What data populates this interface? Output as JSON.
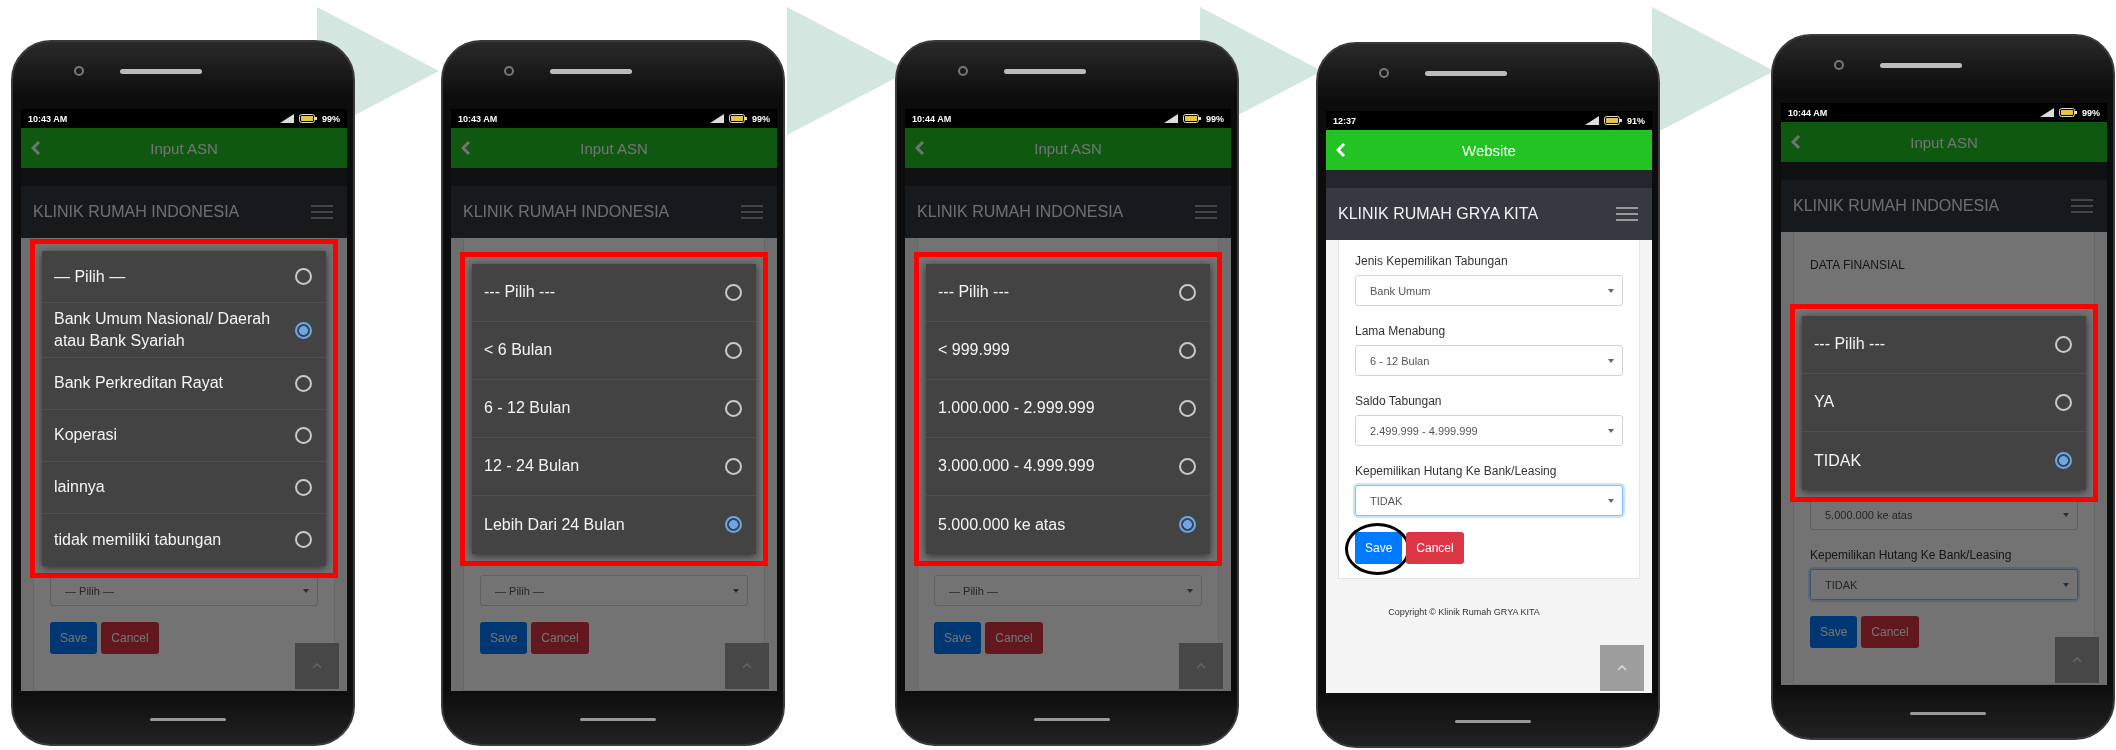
{
  "phones": [
    {
      "status_time": "10:43 AM",
      "battery": "99%",
      "app_title": "Input ASN",
      "site_title": "KLINIK RUMAH INDONESIA",
      "form": {
        "fields": [
          {
            "value": "— Pilih —",
            "focused": false
          }
        ],
        "buttons": [
          {
            "label": "Save",
            "kind": "primary",
            "circled": false
          },
          {
            "label": "Cancel",
            "kind": "danger",
            "circled": false
          }
        ]
      },
      "picker": {
        "highlighted": true,
        "options": [
          {
            "label": "— Pilih —",
            "selected": false
          },
          {
            "label": "Bank Umum Nasional/ Daerah atau Bank Syariah",
            "selected": true
          },
          {
            "label": "Bank Perkreditan Rayat",
            "selected": false
          },
          {
            "label": "Koperasi",
            "selected": false
          },
          {
            "label": "lainnya",
            "selected": false
          },
          {
            "label": "tidak memiliki tabungan",
            "selected": false
          }
        ]
      }
    },
    {
      "status_time": "10:43 AM",
      "battery": "99%",
      "app_title": "Input ASN",
      "site_title": "KLINIK RUMAH INDONESIA",
      "form": {
        "fields": [
          {
            "value": "— Pilih —",
            "focused": false
          }
        ],
        "buttons": [
          {
            "label": "Save",
            "kind": "primary",
            "circled": false
          },
          {
            "label": "Cancel",
            "kind": "danger",
            "circled": false
          }
        ]
      },
      "picker": {
        "highlighted": true,
        "options": [
          {
            "label": "--- Pilih ---",
            "selected": false
          },
          {
            "label": "< 6 Bulan",
            "selected": false
          },
          {
            "label": "6 - 12 Bulan",
            "selected": false
          },
          {
            "label": "12 - 24 Bulan",
            "selected": false
          },
          {
            "label": "Lebih Dari 24 Bulan",
            "selected": true
          }
        ]
      }
    },
    {
      "status_time": "10:44 AM",
      "battery": "99%",
      "app_title": "Input ASN",
      "site_title": "KLINIK RUMAH INDONESIA",
      "form": {
        "fields": [
          {
            "value": "— Pilih —",
            "focused": false
          }
        ],
        "buttons": [
          {
            "label": "Save",
            "kind": "primary",
            "circled": false
          },
          {
            "label": "Cancel",
            "kind": "danger",
            "circled": false
          }
        ]
      },
      "picker": {
        "highlighted": true,
        "options": [
          {
            "label": "--- Pilih ---",
            "selected": false
          },
          {
            "label": "< 999.999",
            "selected": false
          },
          {
            "label": "1.000.000 - 2.999.999",
            "selected": false
          },
          {
            "label": "3.000.000 - 4.999.999",
            "selected": false
          },
          {
            "label": "5.000.000 ke atas",
            "selected": true
          }
        ]
      }
    },
    {
      "status_time": "12:37",
      "battery": "91%",
      "app_title": "Website",
      "site_title": "KLINIK RUMAH GRYA KITA",
      "form": {
        "fields": [
          {
            "label": "Jenis Kepemilikan Tabungan",
            "value": "Bank Umum",
            "focused": false
          },
          {
            "label": "Lama Menabung",
            "value": "6 - 12 Bulan",
            "focused": false
          },
          {
            "label": "Saldo Tabungan",
            "value": "2.499.999 - 4.999.999",
            "focused": false
          },
          {
            "label": "Kepemilikan Hutang Ke Bank/Leasing",
            "value": "TIDAK",
            "focused": true
          }
        ],
        "buttons": [
          {
            "label": "Save",
            "kind": "primary",
            "circled": true
          },
          {
            "label": "Cancel",
            "kind": "danger",
            "circled": false
          }
        ]
      },
      "footer": "Copyright © Klinik Rumah GRYA KITA"
    },
    {
      "status_time": "10:44 AM",
      "battery": "99%",
      "app_title": "Input ASN",
      "site_title": "KLINIK RUMAH INDONESIA",
      "form": {
        "section": "DATA FINANSIAL",
        "fields": [
          {
            "value": "5.000.000 ke atas",
            "focused": false
          },
          {
            "label": "Kepemilikan Hutang Ke Bank/Leasing",
            "value": "TIDAK",
            "focused": true
          }
        ],
        "buttons": [
          {
            "label": "Save",
            "kind": "primary",
            "circled": false
          },
          {
            "label": "Cancel",
            "kind": "danger",
            "circled": false
          }
        ]
      },
      "picker": {
        "highlighted": true,
        "options": [
          {
            "label": "--- Pilih ---",
            "selected": false
          },
          {
            "label": "YA",
            "selected": false
          },
          {
            "label": "TIDAK",
            "selected": true
          }
        ]
      }
    }
  ]
}
